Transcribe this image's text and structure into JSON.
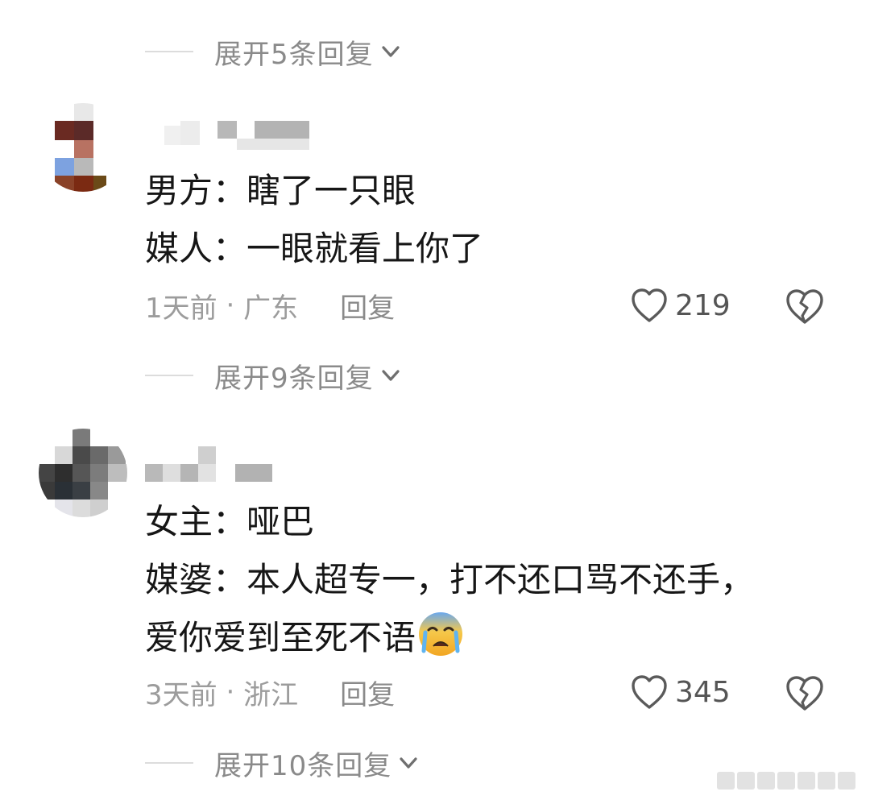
{
  "thread": {
    "expand_top": "展开5条回复"
  },
  "comments": [
    {
      "lines": [
        "男方：瞎了一只眼",
        "媒人：一眼就看上你了"
      ],
      "time": "1天前",
      "location": "广东",
      "reply_label": "回复",
      "likes": "219",
      "expand": "展开9条回复"
    },
    {
      "lines": [
        "女主：哑巴",
        "媒婆：本人超专一，打不还口骂不还手，",
        "爱你爱到至死不语"
      ],
      "emoji": "crying-face",
      "time": "3天前",
      "location": "浙江",
      "reply_label": "回复",
      "likes": "345",
      "expand": "展开10条回复"
    }
  ],
  "icons": {
    "heart": "heart-outline-icon",
    "dislike": "broken-heart-icon",
    "chevron": "chevron-down-icon"
  },
  "colors": {
    "text": "#161616",
    "secondary": "#8a8a8a",
    "meta": "#9c9c9c",
    "divider": "#dcdcdc"
  }
}
